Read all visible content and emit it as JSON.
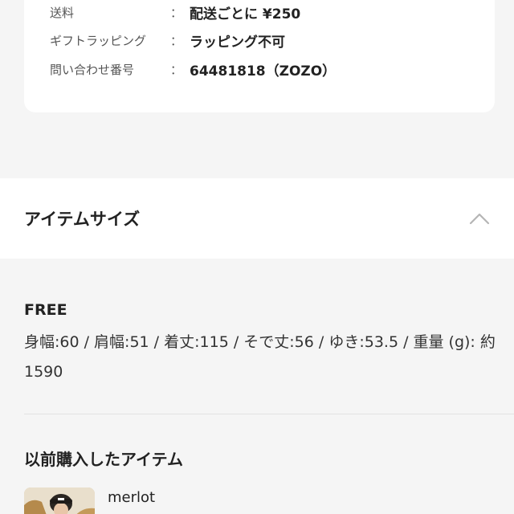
{
  "shop_info": {
    "rows": [
      {
        "label": "送料",
        "colon": "：",
        "value": "配送ごとに ¥250"
      },
      {
        "label": "ギフトラッピング",
        "colon": "：",
        "value": "ラッピング不可"
      },
      {
        "label": "問い合わせ番号",
        "colon": "：",
        "value": "64481818（ZOZO）"
      }
    ]
  },
  "item_size": {
    "title": "アイテムサイズ",
    "expanded": true,
    "chevron_icon": "chevron-up-icon",
    "size_name": "FREE",
    "size_detail": "身幅:60 / 肩幅:51 / 着丈:115 / そで丈:56 / ゆき:53.5 / 重量 (g): 約1590"
  },
  "previous_items": {
    "title": "以前購入したアイテム",
    "items": [
      {
        "brand": "merlot"
      }
    ]
  }
}
